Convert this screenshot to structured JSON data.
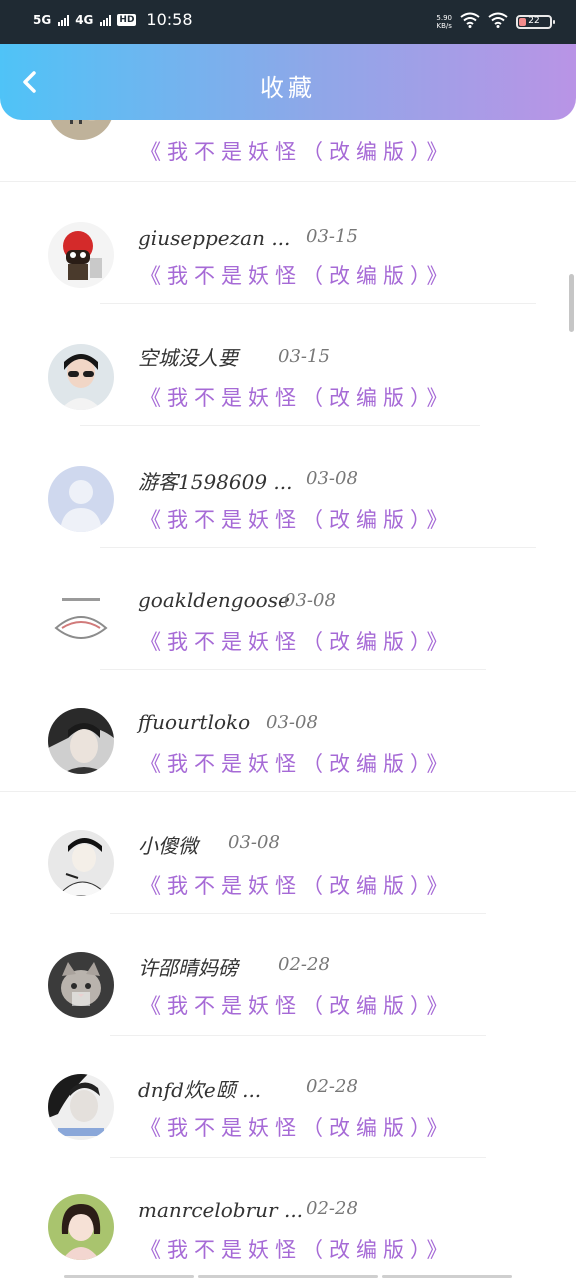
{
  "status_bar": {
    "network_1": "5G",
    "network_2": "4G",
    "hd_badge": "HD",
    "time": "10:58",
    "net_speed_value": "5.90",
    "net_speed_unit": "KB/s",
    "battery_level": "22",
    "battery_fraction": 0.22
  },
  "header": {
    "title": "收藏",
    "back_icon": "chevron-left-icon"
  },
  "favorites": [
    {
      "user": "",
      "date": "",
      "book": "《我不是妖怪（改编版）》",
      "avatar": "ink-painting"
    },
    {
      "user": "giuseppezan ...",
      "date": "03-15",
      "book": "《我不是妖怪（改编版）》",
      "avatar": "red-mascot"
    },
    {
      "user": "空城没人要",
      "date": "03-15",
      "book": "《我不是妖怪（改编版）》",
      "avatar": "girl-sunglasses"
    },
    {
      "user": "游客1598609 ...",
      "date": "03-08",
      "book": "《我不是妖怪（改编版）》",
      "avatar": "default-person"
    },
    {
      "user": "goakldengoose",
      "date": "03-08",
      "book": "《我不是妖怪（改编版）》",
      "avatar": "sketch"
    },
    {
      "user": "ffuourtloko",
      "date": "03-08",
      "book": "《我不是妖怪（改编版）》",
      "avatar": "dark-portrait"
    },
    {
      "user": "小傻微",
      "date": "03-08",
      "book": "《我不是妖怪（改编版）》",
      "avatar": "bw-girl"
    },
    {
      "user": "许邵晴妈磅",
      "date": "02-28",
      "book": "《我不是妖怪（改编版）》",
      "avatar": "cat"
    },
    {
      "user": "dnfd炊e颐 ...",
      "date": "02-28",
      "book": "《我不是妖怪（改编版）》",
      "avatar": "bw-boy"
    },
    {
      "user": "manrcelobrur ...",
      "date": "02-28",
      "book": "《我不是妖怪（改编版）》",
      "avatar": "girl-portrait"
    }
  ],
  "colors": {
    "header_gradient_start": "#4fc3f7",
    "header_gradient_end": "#b994e6",
    "book_title": "#a66ad6",
    "status_bar_bg": "#1f2a33"
  }
}
